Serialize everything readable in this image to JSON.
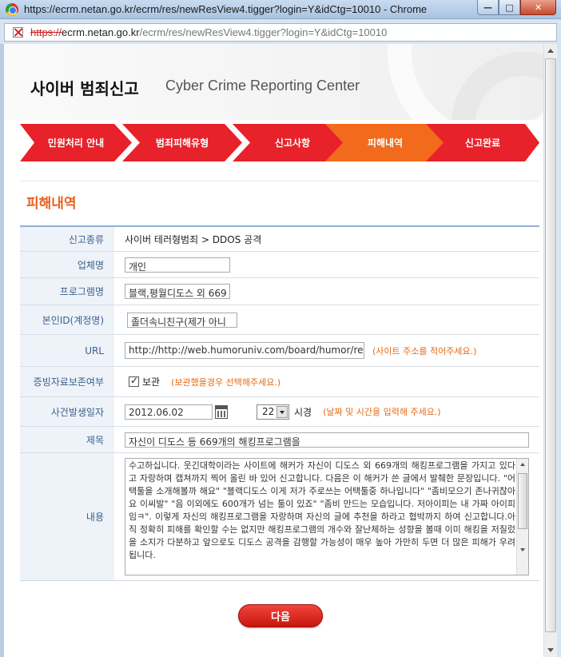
{
  "window": {
    "title": "https://ecrm.netan.go.kr/ecrm/res/newResView4.tigger?login=Y&idCtg=10010 - Chrome",
    "url_proto": "https://",
    "url_host": "ecrm.netan.go.kr",
    "url_path": "/ecrm/res/newResView4.tigger?login=Y&idCtg=10010"
  },
  "header": {
    "brand_ko": "사이버 범죄신고",
    "brand_en": "Cyber Crime Reporting Center"
  },
  "steps": [
    {
      "label": "민원처리 안내",
      "active": false
    },
    {
      "label": "범죄피해유형",
      "active": false
    },
    {
      "label": "신고사항",
      "active": false
    },
    {
      "label": "피해내역",
      "active": true
    },
    {
      "label": "신고완료",
      "active": false
    }
  ],
  "colors": {
    "step_red": "#e8222a",
    "step_active": "#f26a1b",
    "accent_orange": "#e6611e"
  },
  "section_title": "피해내역",
  "form": {
    "report_type_label": "신고종류",
    "report_type_value": "사이버 테러형범죄 > DDOS 공격",
    "company_label": "업체명",
    "company_value": "개인",
    "program_label": "프로그램명",
    "program_value": "블랙,평월디도스 외 669",
    "account_label": "본인ID(계정명)",
    "account_value": "졸더속니친구(제가 아니",
    "url_label": "URL",
    "url_value": "http://http://web.humoruniv.com/board/humor/read",
    "url_hint": "(사이트 주소를 적어주세요.)",
    "evidence_label": "증빙자료보존여부",
    "evidence_checkbox_label": "보관",
    "evidence_hint": "(보관했을경우 선택해주세요.)",
    "date_label": "사건발생일자",
    "date_value": "2012.06.02",
    "hour_value": "22",
    "hour_suffix": "시경",
    "date_hint": "(날짜 및 시간을 입력해 주세요.)",
    "subject_label": "제목",
    "subject_value": "자신이 디도스 등 669개의 해킹프로그램을",
    "content_label": "내용",
    "content_value": "수고하십니다. 웃긴대학이라는 사이트에 해커가 자신이 디도스 외 669개의 해킹프로그램을 가지고 있다고 자랑하며 캡쳐까지 찍어 올린 바 있어 신고합니다. 다음은 이 해커가 쓴 글에서 발췌한 문장입니다. \"어택툴을 소개해볼까 해요\" \"블랙디도스 이게 저가 주로쓰는 어택툴중 하나입니다\" \"좀비모으기 존나귀찮아요 이씨발\" \"음 이외에도 600개가 넘는 툴이 있죠\" \"좀비 만드는 모습입니다. 저아이피는 내 가짜 아이피임ㅋ\". 이렇게 자신의 해킹프로그램을 자랑하며 자신의 글에 추천을 하라고 협박까지 하여 신고합니다.아직 정확히 피해를 확인할 수는 없지만 해킹프로그램의 개수와 잘난체하는 성향을 볼때 이미 해킹을 저질렀을 소지가 다분하고 앞으로도 디도스 공격을 감행할 가능성이 매우 높아 가만히 두면 더 많은 피해가 우려됩니다."
  },
  "next_button": "다음"
}
